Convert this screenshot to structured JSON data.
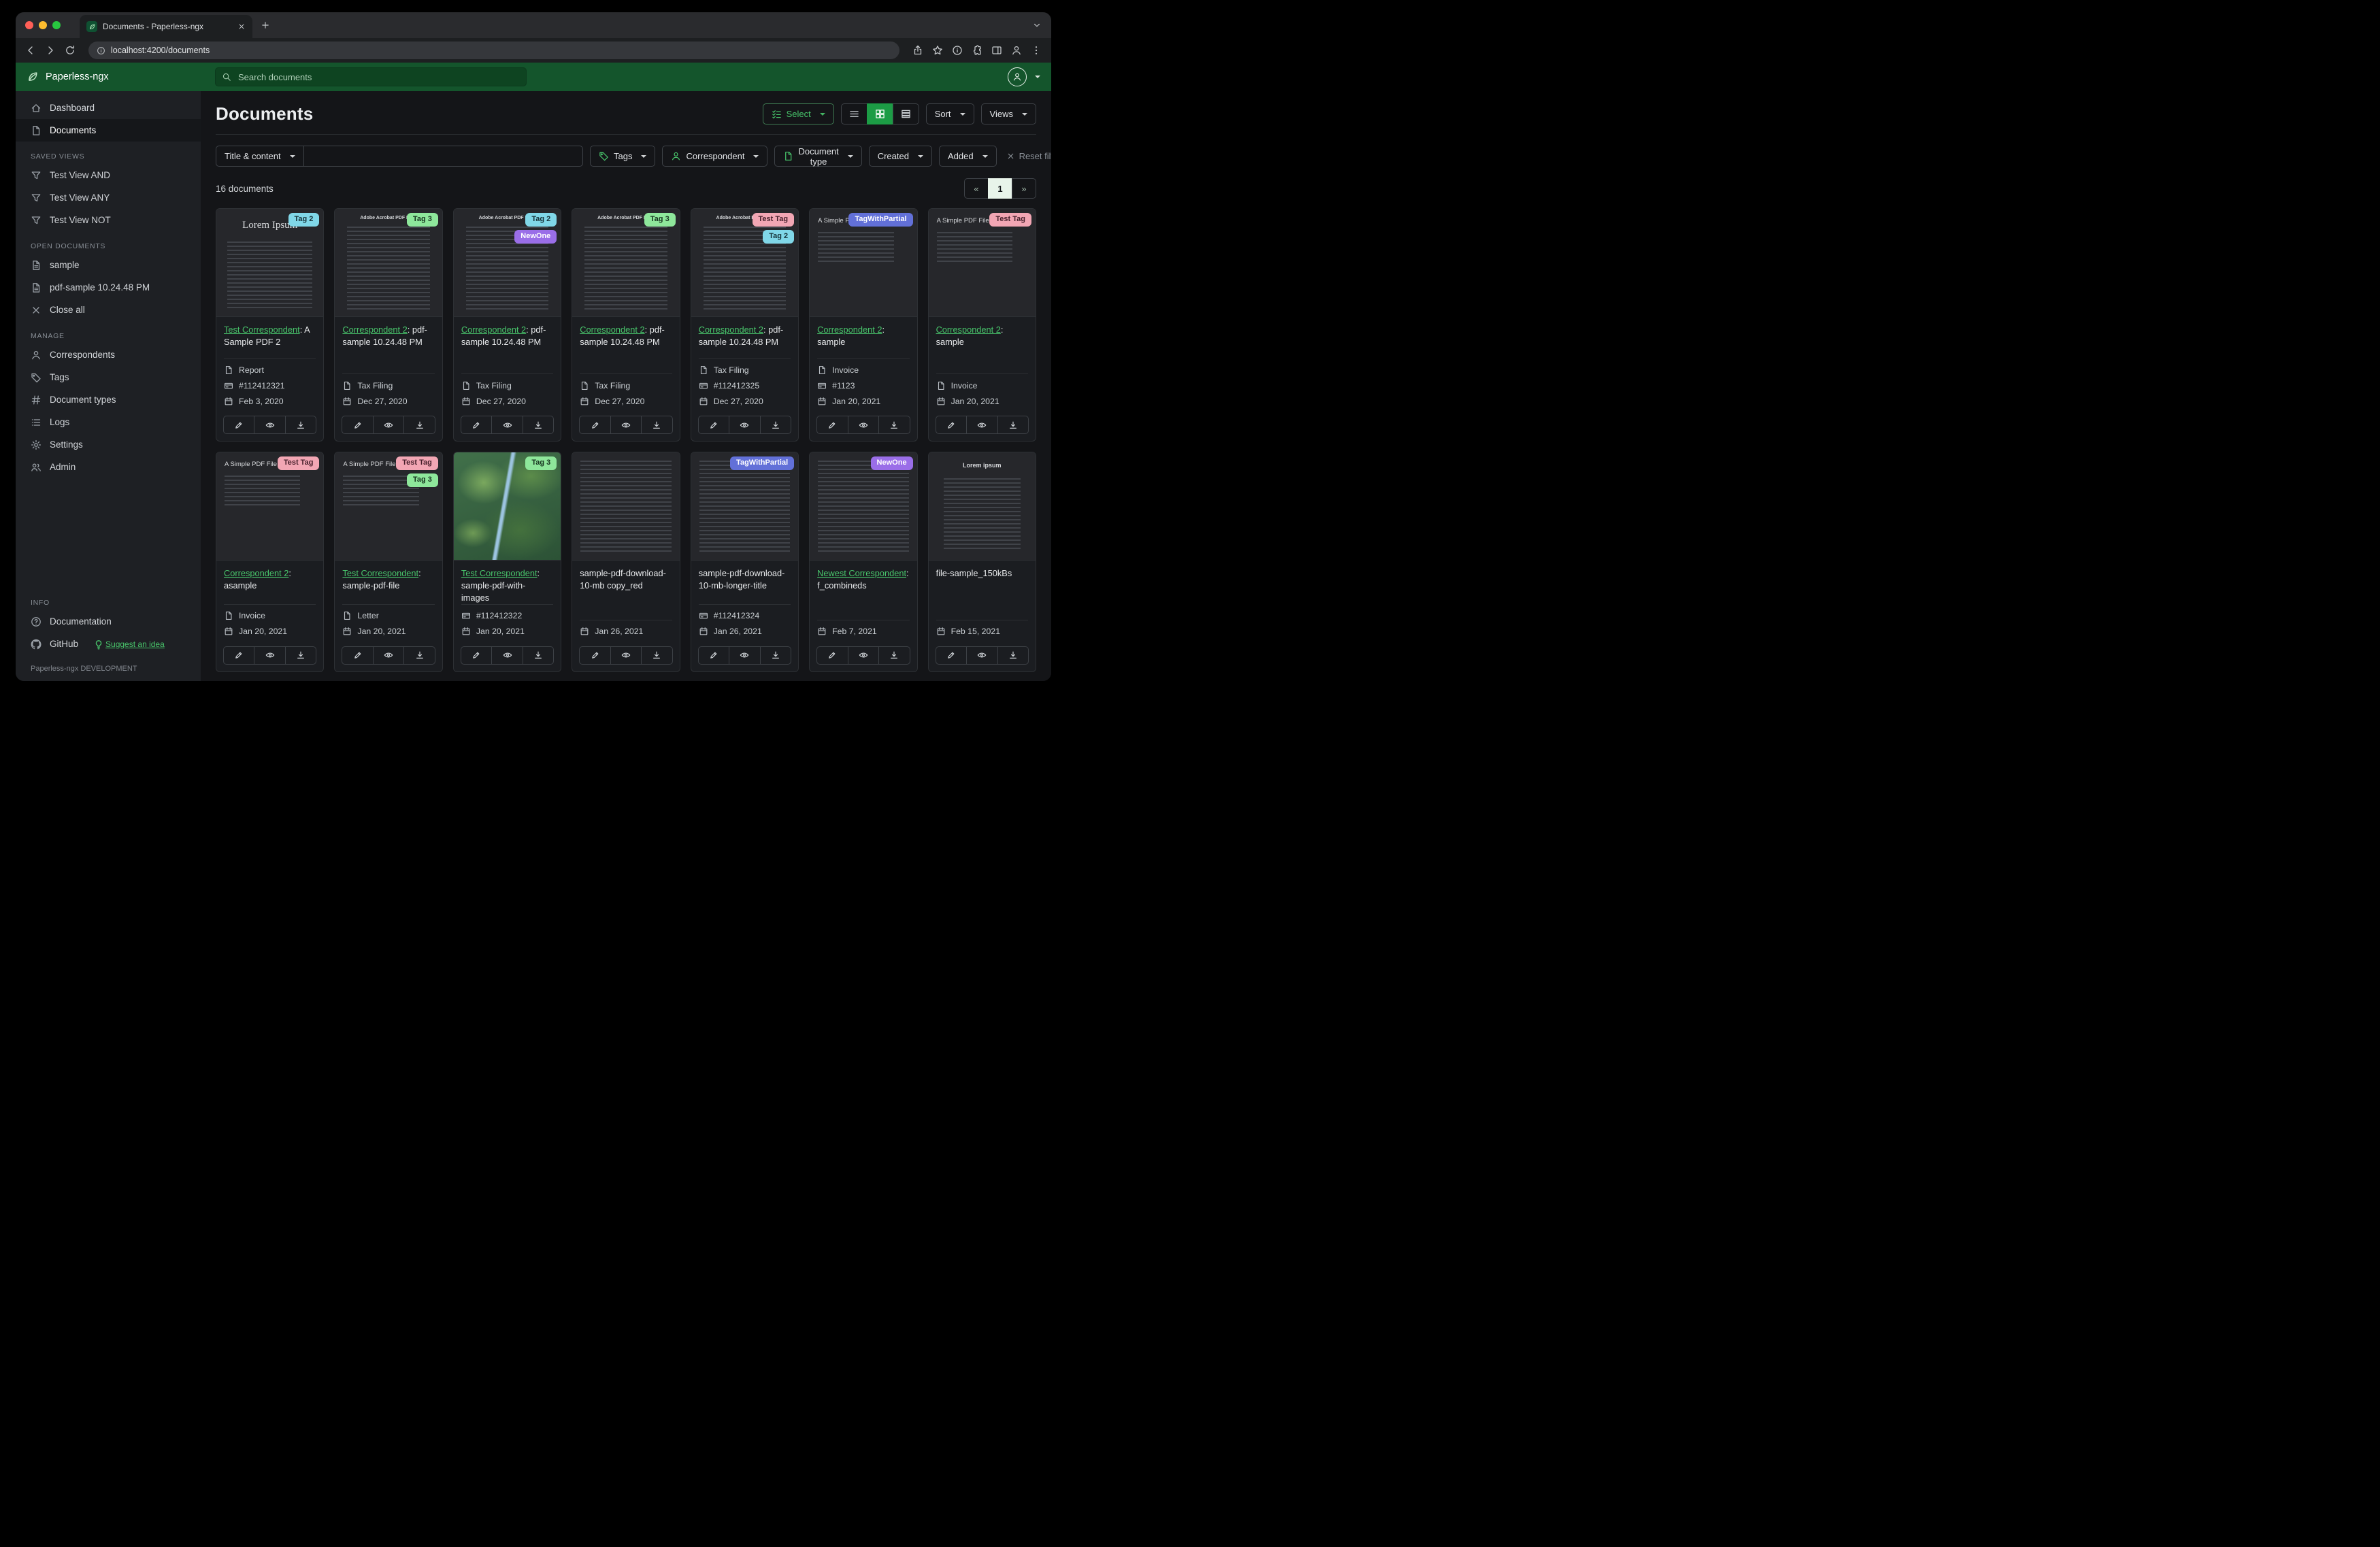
{
  "colors": {
    "header_green": "#14552c",
    "search_bg": "#0e4421",
    "accent": "#48c56b",
    "active_green": "#1c9c45",
    "page_active": "#e8f4ea"
  },
  "browser": {
    "tab_title": "Documents - Paperless-ngx",
    "url": "localhost:4200/documents"
  },
  "header": {
    "brand": "Paperless-ngx",
    "search_placeholder": "Search documents"
  },
  "sidebar": {
    "primary": [
      {
        "label": "Dashboard",
        "icon": "home",
        "active": false
      },
      {
        "label": "Documents",
        "icon": "doc",
        "active": true
      }
    ],
    "sections": [
      {
        "title": "SAVED VIEWS",
        "items": [
          {
            "label": "Test View AND",
            "icon": "funnel"
          },
          {
            "label": "Test View ANY",
            "icon": "funnel"
          },
          {
            "label": "Test View NOT",
            "icon": "funnel"
          }
        ]
      },
      {
        "title": "OPEN DOCUMENTS",
        "items": [
          {
            "label": "sample",
            "icon": "doc-text"
          },
          {
            "label": "pdf-sample 10.24.48 PM",
            "icon": "doc-text"
          },
          {
            "label": "Close all",
            "icon": "x"
          }
        ]
      },
      {
        "title": "MANAGE",
        "items": [
          {
            "label": "Correspondents",
            "icon": "person"
          },
          {
            "label": "Tags",
            "icon": "tag"
          },
          {
            "label": "Document types",
            "icon": "hash"
          },
          {
            "label": "Logs",
            "icon": "list"
          },
          {
            "label": "Settings",
            "icon": "gear"
          },
          {
            "label": "Admin",
            "icon": "users"
          }
        ]
      },
      {
        "title": "INFO",
        "push": true,
        "items": [
          {
            "label": "Documentation",
            "icon": "question"
          },
          {
            "label": "GitHub",
            "icon": "github",
            "extra": {
              "label": "Suggest an idea",
              "icon": "bulb"
            }
          }
        ]
      }
    ],
    "footer": "Paperless-ngx DEVELOPMENT"
  },
  "main": {
    "title": "Documents",
    "toolbar": {
      "select_label": "Select",
      "sort_label": "Sort",
      "views_label": "Views"
    },
    "filters": {
      "title_content_label": "Title & content",
      "tags_label": "Tags",
      "correspondent_label": "Correspondent",
      "document_type_label": "Document type",
      "created_label": "Created",
      "added_label": "Added",
      "reset_label": "Reset filters"
    },
    "count_label": "16 documents",
    "pagination": {
      "prev": "«",
      "page": "1",
      "next": "»"
    }
  },
  "tag_palette": {
    "Tag 2": {
      "bg": "#80d7e8",
      "fg": "#163238"
    },
    "Tag 3": {
      "bg": "#8ee79b",
      "fg": "#173520"
    },
    "NewOne": {
      "bg": "#9a6ee8",
      "fg": "#ffffff"
    },
    "Test Tag": {
      "bg": "#f2a6b4",
      "fg": "#47202c"
    },
    "TagWithPartial": {
      "bg": "#6270d8",
      "fg": "#ffffff"
    }
  },
  "documents": [
    {
      "correspondent": "Test Correspondent",
      "title_text": ": A Sample PDF 2",
      "tags": [
        "Tag 2"
      ],
      "type": "Report",
      "asn": "#112412321",
      "date": "Feb 3, 2020",
      "thumb": {
        "variant": "lorem",
        "heading": "Lorem Ipsum"
      }
    },
    {
      "correspondent": "Correspondent 2",
      "title_text": ": pdf-sample 10.24.48 PM",
      "tags": [
        "Tag 3"
      ],
      "type": "Tax Filing",
      "date": "Dec 27, 2020",
      "thumb": {
        "variant": "adobe",
        "heading": "Adobe Acrobat PDF Files"
      }
    },
    {
      "correspondent": "Correspondent 2",
      "title_text": ": pdf-sample 10.24.48 PM",
      "tags": [
        "Tag 2",
        "NewOne"
      ],
      "type": "Tax Filing",
      "date": "Dec 27, 2020",
      "thumb": {
        "variant": "adobe",
        "heading": "Adobe Acrobat PDF Files"
      }
    },
    {
      "correspondent": "Correspondent 2",
      "title_text": ": pdf-sample 10.24.48 PM",
      "tags": [
        "Tag 3"
      ],
      "type": "Tax Filing",
      "date": "Dec 27, 2020",
      "thumb": {
        "variant": "adobe",
        "heading": "Adobe Acrobat PDF Files"
      }
    },
    {
      "correspondent": "Correspondent 2",
      "title_text": ": pdf-sample 10.24.48 PM",
      "tags": [
        "Test Tag",
        "Tag 2"
      ],
      "type": "Tax Filing",
      "asn": "#112412325",
      "date": "Dec 27, 2020",
      "thumb": {
        "variant": "adobe",
        "heading": "Adobe Acrobat PDF Files"
      }
    },
    {
      "correspondent": "Correspondent 2",
      "title_text": ": sample",
      "tags": [
        "TagWithPartial"
      ],
      "type": "Invoice",
      "asn": "#1123",
      "date": "Jan 20, 2021",
      "thumb": {
        "variant": "simple",
        "heading": "A Simple PDF File"
      }
    },
    {
      "correspondent": "Correspondent 2",
      "title_text": ": sample",
      "tags": [
        "Test Tag"
      ],
      "type": "Invoice",
      "date": "Jan 20, 2021",
      "thumb": {
        "variant": "simple",
        "heading": "A Simple PDF File"
      }
    },
    {
      "correspondent": "Correspondent 2",
      "title_text": ": asample",
      "tags": [
        "Test Tag"
      ],
      "type": "Invoice",
      "date": "Jan 20, 2021",
      "thumb": {
        "variant": "simple",
        "heading": "A Simple PDF File"
      }
    },
    {
      "correspondent": "Test Correspondent",
      "title_text": ": sample-pdf-file",
      "tags": [
        "Test Tag",
        "Tag 3"
      ],
      "type": "Letter",
      "date": "Jan 20, 2021",
      "thumb": {
        "variant": "simple",
        "heading": "A Simple PDF File"
      }
    },
    {
      "correspondent": "Test Correspondent",
      "title_text": ": sample-pdf-with-images",
      "tags": [
        "Tag 3"
      ],
      "asn": "#112412322",
      "date": "Jan 20, 2021",
      "thumb": {
        "variant": "map"
      }
    },
    {
      "title_text": "sample-pdf-download-10-mb copy_red",
      "tags": [],
      "date": "Jan 26, 2021",
      "thumb": {
        "variant": "text"
      }
    },
    {
      "title_text": "sample-pdf-download-10-mb-longer-title",
      "tags": [
        "TagWithPartial"
      ],
      "asn": "#112412324",
      "date": "Jan 26, 2021",
      "thumb": {
        "variant": "text"
      }
    },
    {
      "correspondent": "Newest Correspondent",
      "title_text": ": f_combineds",
      "tags": [
        "NewOne"
      ],
      "date": "Feb 7, 2021",
      "thumb": {
        "variant": "text"
      }
    },
    {
      "title_text": "file-sample_150kBs",
      "tags": [],
      "date": "Feb 15, 2021",
      "thumb": {
        "variant": "lorem2",
        "heading": "Lorem ipsum"
      }
    }
  ]
}
